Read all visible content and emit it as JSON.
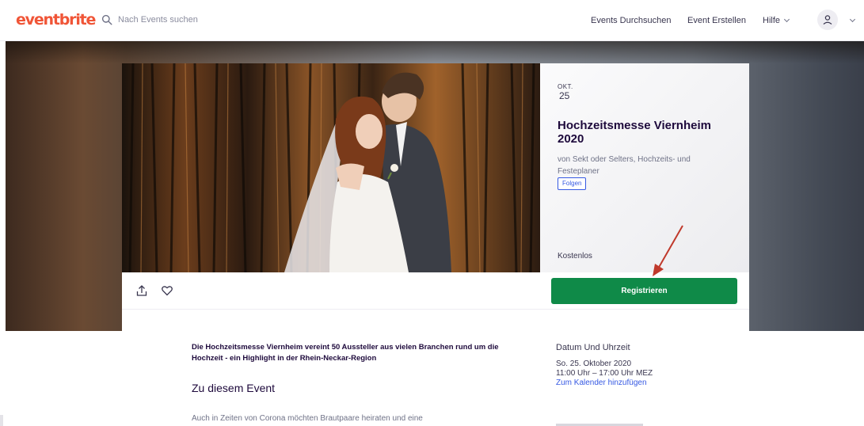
{
  "header": {
    "logo": "eventbrite",
    "search_placeholder": "Nach Events suchen",
    "nav": {
      "browse": "Events Durchsuchen",
      "create": "Event Erstellen",
      "help": "Hilfe"
    }
  },
  "event": {
    "month": "OKT.",
    "day": "25",
    "title": "Hochzeitsmesse Viernheim 2020",
    "organizer": "von Sekt oder Selters, Hochzeits- und Festeplaner",
    "follow_label": "Folgen",
    "price": "Kostenlos",
    "register_label": "Registrieren",
    "summary": "Die Hochzeitsmesse Viernheim vereint 50 Aussteller aus vielen Branchen rund um die Hochzeit - ein Highlight in der Rhein-Neckar-Region",
    "about_title": "Zu diesem Event",
    "about_text": "Auch in Zeiten von Corona möchten Brautpaare heiraten und eine"
  },
  "datetime": {
    "heading": "Datum Und Uhrzeit",
    "line1": "So. 25. Oktober 2020",
    "line2": "11:00 Uhr – 17:00 Uhr MEZ",
    "calendar_link": "Zum Kalender hinzufügen"
  },
  "colors": {
    "brand": "#f05537",
    "register": "#0f8a48",
    "link": "#3659e3",
    "annotation_arrow": "#c0392b"
  },
  "icons": [
    "search-icon",
    "chevron-down-icon",
    "user-icon",
    "share-icon",
    "heart-icon"
  ]
}
